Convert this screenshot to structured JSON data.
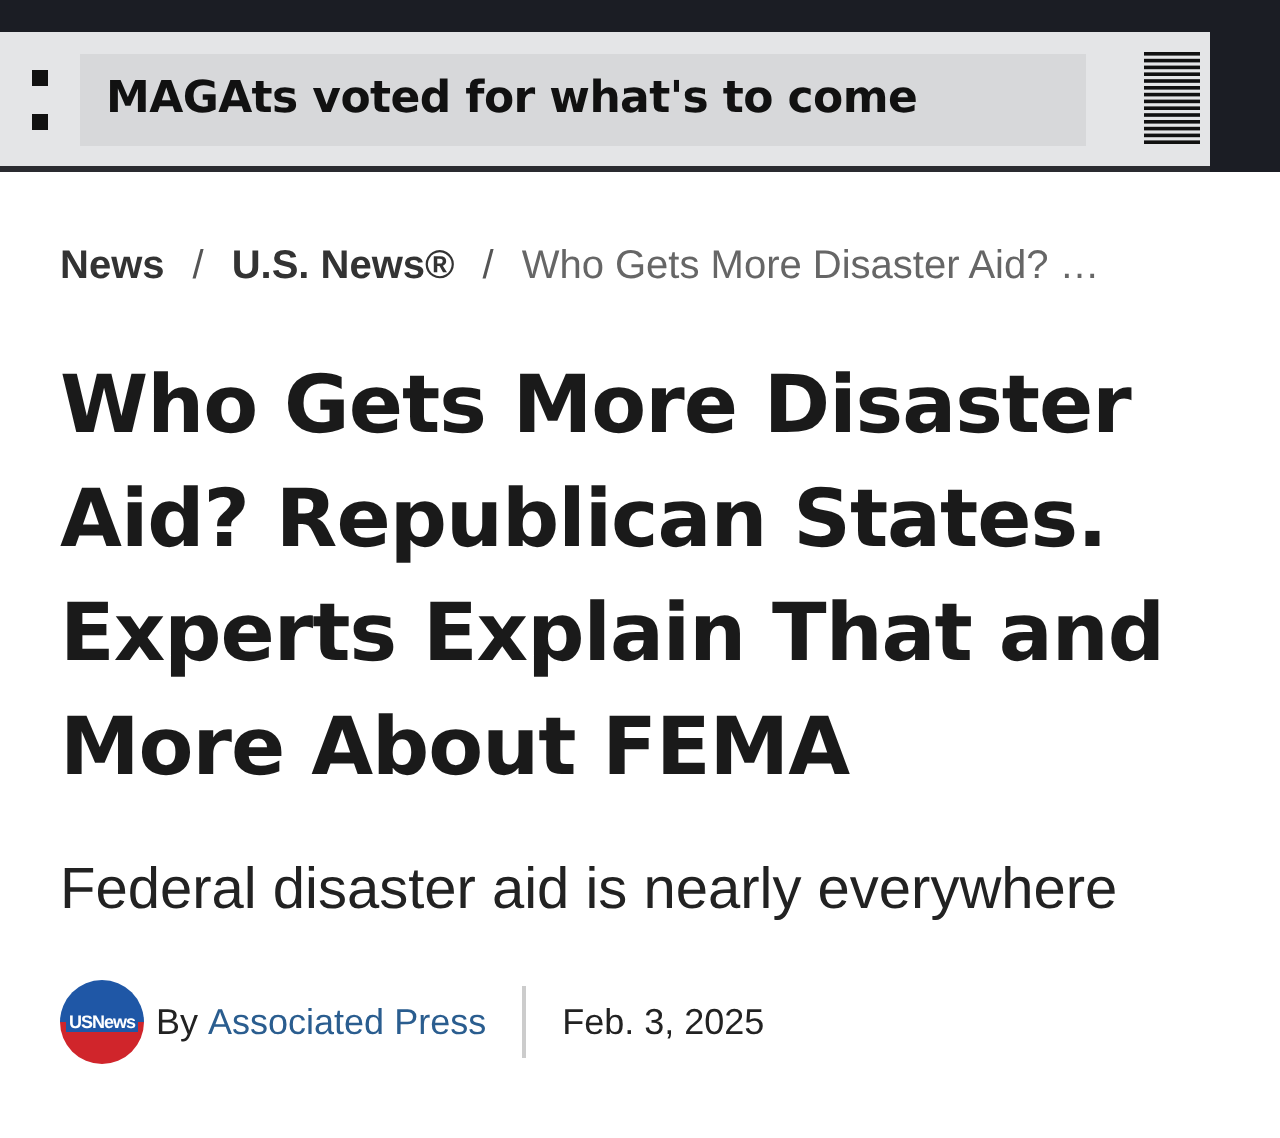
{
  "overlay_caption": "MAGAts voted for what's to come",
  "breadcrumbs": [
    {
      "label": "News",
      "current": false
    },
    {
      "label": "U.S. News®",
      "current": false
    },
    {
      "label": "Who Gets More Disaster Aid? …",
      "current": true
    }
  ],
  "breadcrumb_separator": "/",
  "headline": "Who Gets More Disaster Aid? Republican States. Experts Explain That and More About FEMA",
  "subheadline": "Federal disaster aid is nearly everywhere",
  "byline": {
    "avatar_text": "USNews",
    "prefix": "By",
    "author": "Associated Press",
    "date": "Feb. 3, 2025"
  }
}
